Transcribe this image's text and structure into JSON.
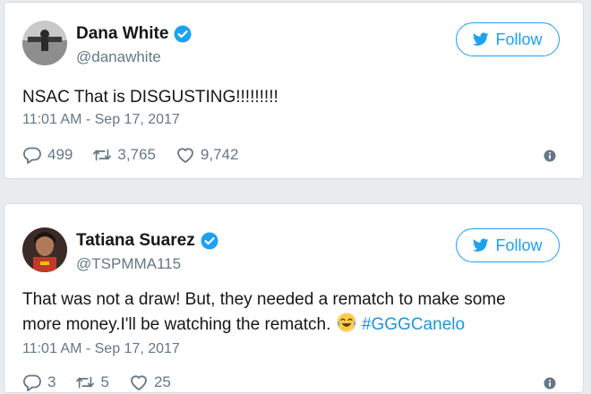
{
  "tweets": [
    {
      "name": "Dana White",
      "handle": "@danawhite",
      "follow_label": "Follow",
      "text": "NSAC That is DISGUSTING!!!!!!!!!",
      "timestamp": "11:01 AM - Sep 17, 2017",
      "replies": "499",
      "retweets": "3,765",
      "likes": "9,742"
    },
    {
      "name": "Tatiana Suarez",
      "handle": "@TSPMMA115",
      "follow_label": "Follow",
      "text_line1": "That was not a draw! But, they needed a rematch to make some",
      "text_line2": "more money.I'll be watching the rematch. ",
      "hashtag": "#GGGCanelo",
      "timestamp": "11:01 AM - Sep 17, 2017",
      "replies": "3",
      "retweets": "5",
      "likes": "25"
    }
  ],
  "icons": {
    "verified": "verified-badge-icon",
    "bird": "twitter-bird-icon",
    "reply": "reply-icon",
    "retweet": "retweet-icon",
    "like": "heart-icon",
    "info": "info-icon",
    "emoji": "tears-of-joy-emoji"
  },
  "colors": {
    "accent": "#1da1f2",
    "hashtag": "#1b95e0",
    "muted": "#657786",
    "text": "#14171a"
  }
}
